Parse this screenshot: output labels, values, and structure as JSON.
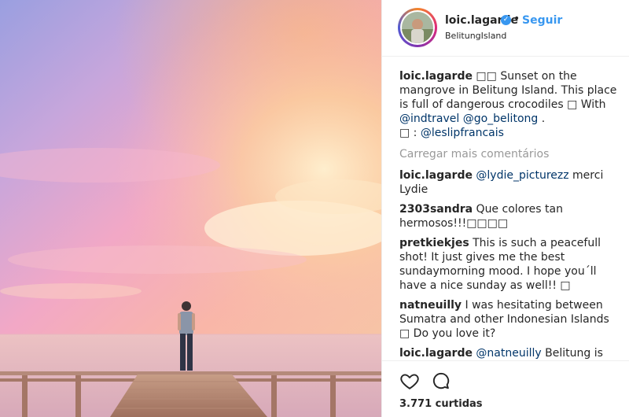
{
  "post": {
    "username": "loic.lagarde",
    "verified_mark": "✓",
    "separator": "•",
    "follow_label": "Seguir",
    "location": "BelitungIsland"
  },
  "caption": {
    "user": "loic.lagarde",
    "text_1": " □□ Sunset on the mangrove in Belitung Island. This place is full of dangerous crocodiles □ With ",
    "mention_1": "@indtravel",
    "text_2": " ",
    "mention_2": "@go_belitong",
    "text_3": " .\n□ : ",
    "mention_3": "@leslipfrancais"
  },
  "load_more_label": "Carregar mais comentários",
  "comments": [
    {
      "user": "loic.lagarde",
      "mention": "@lydie_picturezz",
      "text": " merci Lydie"
    },
    {
      "user": "2303sandra",
      "mention": "",
      "text": " Que colores tan hermosos!!!□□□□"
    },
    {
      "user": "pretkiekjes",
      "mention": "",
      "text": " This is such a peacefull shot! It just gives me the best sundaymorning mood. I hope you´ll have a nice sunday as well!! □"
    },
    {
      "user": "natneuilly",
      "mention": "",
      "text": " I was hesitating between Sumatra and other Indonesian Islands □ Do you love it?"
    },
    {
      "user": "loic.lagarde",
      "mention": "@natneuilly",
      "text": " Belitung is very nice because there is no tourist"
    }
  ],
  "likes": "3.771 curtidas",
  "icons": {
    "like": "heart-icon",
    "comment": "comment-icon",
    "verified": "verified-badge-icon"
  },
  "colors": {
    "link": "#3897f0",
    "mention": "#003569",
    "muted": "#999999",
    "text": "#262626"
  }
}
